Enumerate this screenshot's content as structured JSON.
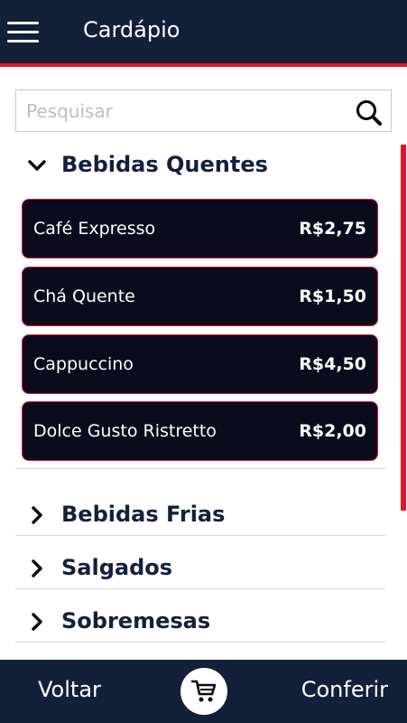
{
  "header": {
    "title": "Cardápio"
  },
  "search": {
    "placeholder": "Pesquisar"
  },
  "categories": [
    {
      "label": "Bebidas Quentes",
      "expanded": true,
      "items": [
        {
          "name": "Café Expresso",
          "price": "R$2,75"
        },
        {
          "name": "Chá Quente",
          "price": "R$1,50"
        },
        {
          "name": "Cappuccino",
          "price": "R$4,50"
        },
        {
          "name": "Dolce Gusto Ristretto",
          "price": "R$2,00"
        }
      ]
    },
    {
      "label": "Bebidas Frias",
      "expanded": false
    },
    {
      "label": "Salgados",
      "expanded": false
    },
    {
      "label": "Sobremesas",
      "expanded": false
    }
  ],
  "footer": {
    "back_label": "Voltar",
    "confirm_label": "Conferir"
  },
  "colors": {
    "navy": "#13203a",
    "accent": "#e0162b",
    "item_bg": "#0b0b1e"
  }
}
